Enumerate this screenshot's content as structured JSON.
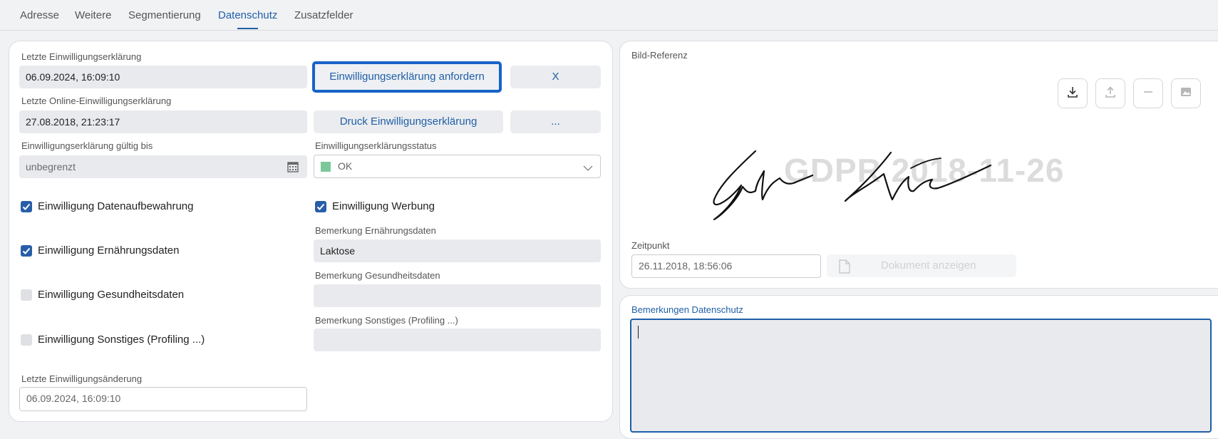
{
  "tabs": [
    {
      "label": "Adresse"
    },
    {
      "label": "Weitere"
    },
    {
      "label": "Segmentierung"
    },
    {
      "label": "Datenschutz"
    },
    {
      "label": "Zusatzfelder"
    }
  ],
  "left": {
    "last_consent_label": "Letzte Einwilligungserklärung",
    "last_consent_value": "06.09.2024, 16:09:10",
    "request_button": "Einwilligungserklärung anfordern",
    "x_button": "X",
    "last_online_label": "Letzte Online-Einwilligungserklärung",
    "last_online_value": "27.08.2018, 21:23:17",
    "print_button": "Druck Einwilligungserklärung",
    "more_button": "...",
    "valid_until_label": "Einwilligungserklärung gültig bis",
    "valid_until_value": "unbegrenzt",
    "status_label": "Einwilligungserklärungsstatus",
    "status_value": "OK",
    "status_color": "#7cc89b",
    "checkboxes": [
      {
        "label": "Einwilligung Datenaufbewahrung",
        "checked": true
      },
      {
        "label": "Einwilligung Werbung",
        "checked": true
      },
      {
        "label": "Einwilligung Ernährungsdaten",
        "checked": true
      },
      {
        "label": "Einwilligung Gesundheitsdaten",
        "checked": false
      },
      {
        "label": "Einwilligung Sonstiges (Profiling ...)",
        "checked": false
      }
    ],
    "remark_nutrition_label": "Bemerkung Ernährungsdaten",
    "remark_nutrition_value": "Laktose",
    "remark_health_label": "Bemerkung Gesundheitsdaten",
    "remark_health_value": "",
    "remark_other_label": "Bemerkung Sonstiges (Profiling ...)",
    "remark_other_value": "",
    "last_change_label": "Letzte Einwilligungsänderung",
    "last_change_value": "06.09.2024, 16:09:10"
  },
  "image_ref": {
    "label": "Bild-Referenz",
    "watermark": "GDPR 2018-11-26",
    "toolbar_icons": [
      "download-icon",
      "upload-icon",
      "minus-icon",
      "image-icon"
    ],
    "time_label": "Zeitpunkt",
    "time_value": "26.11.2018, 18:56:06",
    "show_doc_button": "Dokument anzeigen"
  },
  "remarks": {
    "label": "Bemerkungen Datenschutz",
    "value": ""
  },
  "colors": {
    "accent": "#1f5fa8",
    "focus": "#1663c7"
  }
}
